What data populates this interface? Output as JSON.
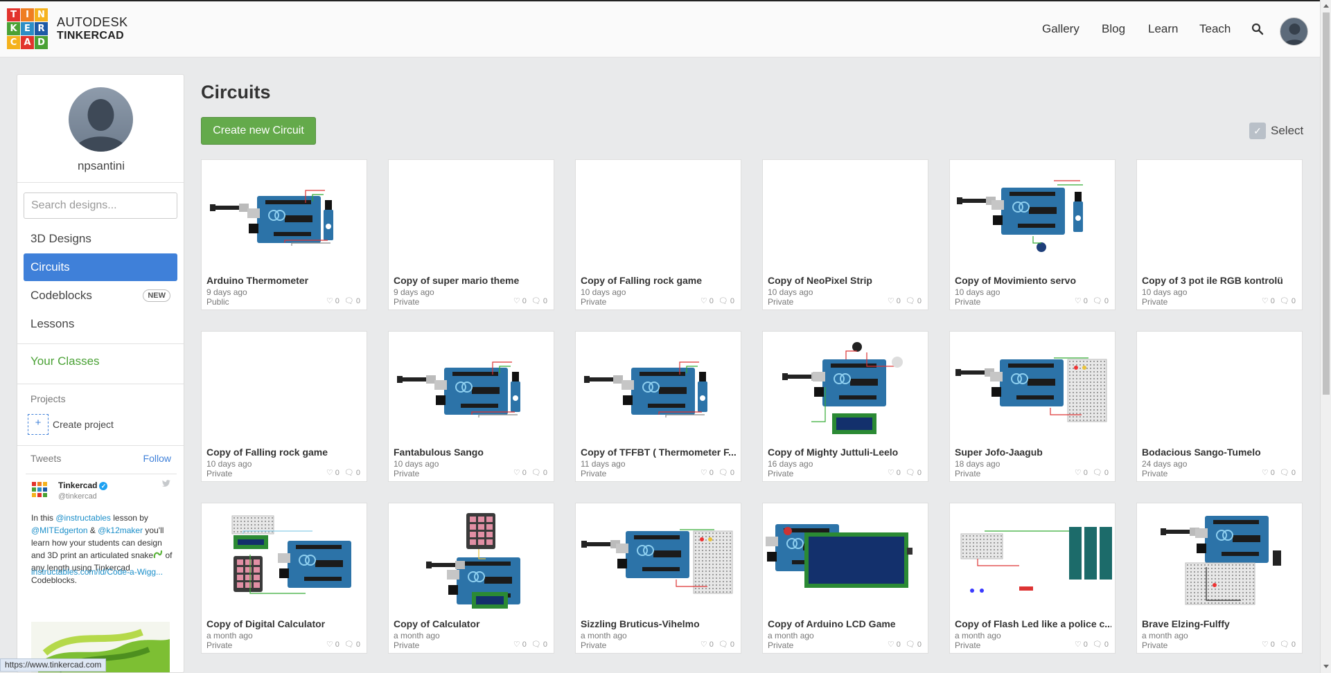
{
  "header": {
    "brand_line1": "AUTODESK",
    "brand_line2": "TINKERCAD",
    "logo_letters": [
      "T",
      "I",
      "N",
      "K",
      "E",
      "R",
      "C",
      "A",
      "D"
    ],
    "nav": [
      "Gallery",
      "Blog",
      "Learn",
      "Teach"
    ],
    "search_icon": "search-icon",
    "avatar_icon": "user-avatar"
  },
  "sidebar": {
    "username": "npsantini",
    "search_placeholder": "Search designs...",
    "menu": [
      {
        "label": "3D Designs",
        "active": false
      },
      {
        "label": "Circuits",
        "active": true
      },
      {
        "label": "Codeblocks",
        "active": false,
        "badge": "NEW"
      },
      {
        "label": "Lessons",
        "active": false
      }
    ],
    "classes_label": "Your Classes",
    "projects_heading": "Projects",
    "create_project_label": "Create project",
    "tweets_heading": "Tweets",
    "follow_label": "Follow",
    "tweet": {
      "name": "Tinkercad",
      "handle": "@tinkercad",
      "text_parts": [
        "In this ",
        "@instructables",
        " lesson by ",
        "@MITEdgerton",
        " & ",
        "@k12maker",
        " you'll learn how your students can design and 3D print an articulated snake",
        " of any length using Tinkercad Codeblocks."
      ],
      "url": "instructables.com/id/Code-a-Wigg..."
    }
  },
  "main": {
    "title": "Circuits",
    "create_button": "Create new Circuit",
    "select_label": "Select",
    "cards": [
      {
        "title": "Arduino Thermometer",
        "date": "9 days ago",
        "visibility": "Public",
        "likes": "0",
        "comments": "0",
        "thumb": "servo"
      },
      {
        "title": "Copy of super mario theme",
        "date": "9 days ago",
        "visibility": "Private",
        "likes": "0",
        "comments": "0",
        "thumb": "blank"
      },
      {
        "title": "Copy of Falling rock game",
        "date": "10 days ago",
        "visibility": "Private",
        "likes": "0",
        "comments": "0",
        "thumb": "blank"
      },
      {
        "title": "Copy of NeoPixel Strip",
        "date": "10 days ago",
        "visibility": "Private",
        "likes": "0",
        "comments": "0",
        "thumb": "blank"
      },
      {
        "title": "Copy of Movimiento servo",
        "date": "10 days ago",
        "visibility": "Private",
        "likes": "0",
        "comments": "0",
        "thumb": "servo2"
      },
      {
        "title": "Copy of 3 pot ile RGB kontrolü",
        "date": "10 days ago",
        "visibility": "Private",
        "likes": "0",
        "comments": "0",
        "thumb": "blank"
      },
      {
        "title": "Copy of Falling rock game",
        "date": "10 days ago",
        "visibility": "Private",
        "likes": "0",
        "comments": "0",
        "thumb": "blank"
      },
      {
        "title": "Fantabulous Sango",
        "date": "10 days ago",
        "visibility": "Private",
        "likes": "0",
        "comments": "0",
        "thumb": "servo"
      },
      {
        "title": "Copy of TFFBT ( Thermometer F...",
        "date": "11 days ago",
        "visibility": "Private",
        "likes": "0",
        "comments": "0",
        "thumb": "servo"
      },
      {
        "title": "Copy of Mighty Juttuli-Leelo",
        "date": "16 days ago",
        "visibility": "Private",
        "likes": "0",
        "comments": "0",
        "thumb": "lcdsmall"
      },
      {
        "title": "Super Jofo-Jaagub",
        "date": "18 days ago",
        "visibility": "Private",
        "likes": "0",
        "comments": "0",
        "thumb": "breadboard"
      },
      {
        "title": "Bodacious Sango-Tumelo",
        "date": "24 days ago",
        "visibility": "Private",
        "likes": "0",
        "comments": "0",
        "thumb": "blank"
      },
      {
        "title": "Copy of Digital Calculator",
        "date": "a month ago",
        "visibility": "Private",
        "likes": "0",
        "comments": "0",
        "thumb": "keypad"
      },
      {
        "title": "Copy of Calculator",
        "date": "a month ago",
        "visibility": "Private",
        "likes": "0",
        "comments": "0",
        "thumb": "keypad2"
      },
      {
        "title": "Sizzling Bruticus-Vihelmo",
        "date": "a month ago",
        "visibility": "Private",
        "likes": "0",
        "comments": "0",
        "thumb": "breadboard"
      },
      {
        "title": "Copy of Arduino LCD Game",
        "date": "a month ago",
        "visibility": "Private",
        "likes": "0",
        "comments": "0",
        "thumb": "lcdbig"
      },
      {
        "title": "Copy of Flash Led like a police c...",
        "date": "a month ago",
        "visibility": "Private",
        "likes": "0",
        "comments": "0",
        "thumb": "batteries"
      },
      {
        "title": "Brave Elzing-Fulffy",
        "date": "a month ago",
        "visibility": "Private",
        "likes": "0",
        "comments": "0",
        "thumb": "breadboard2"
      }
    ]
  },
  "status_bar_url": "https://www.tinkercad.com",
  "colors": {
    "logo": [
      "#e2332d",
      "#ef7d22",
      "#f5b21d",
      "#4aa135",
      "#2c8ec6",
      "#1d5aa6"
    ],
    "active_menu": "#3f80d9",
    "create_button": "#64aa4b",
    "classes_link": "#4aa135"
  }
}
